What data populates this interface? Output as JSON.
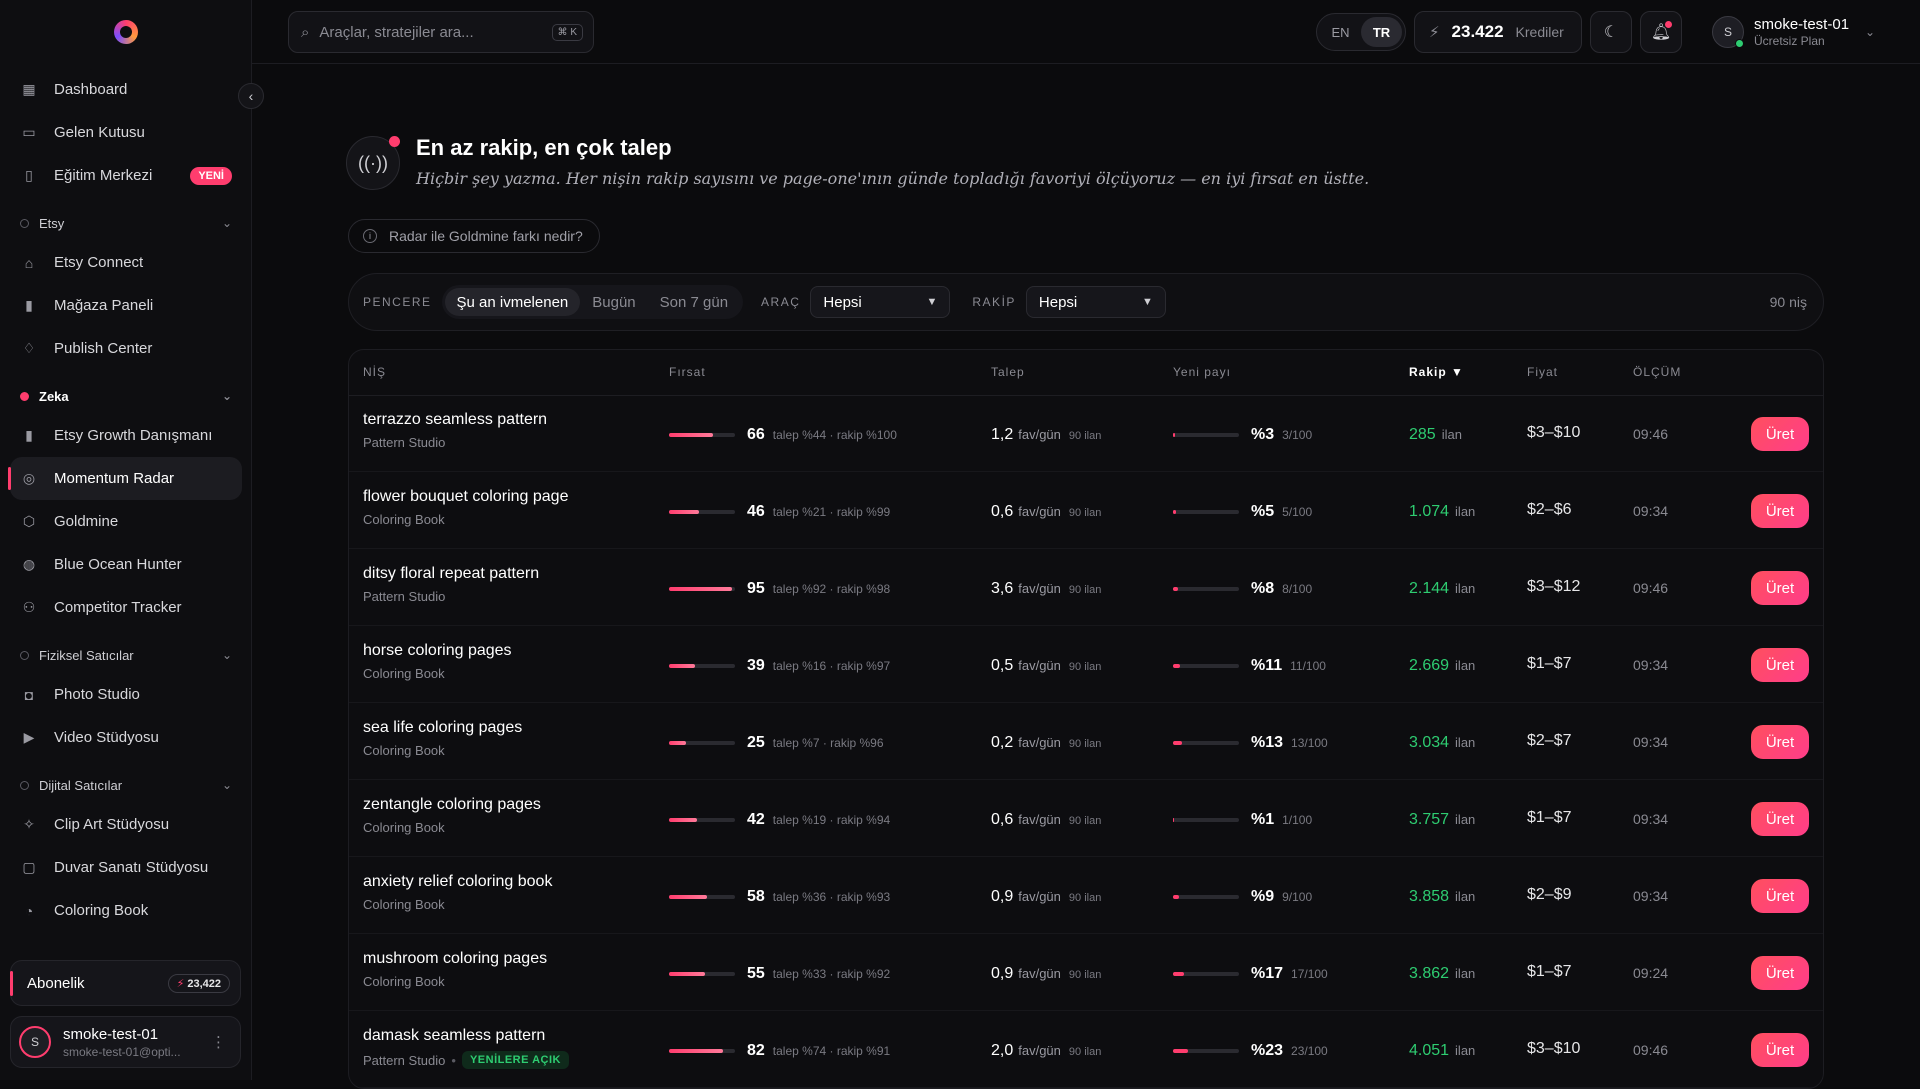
{
  "sidebar": {
    "top_items": [
      {
        "label": "Dashboard",
        "icon": "grid-icon"
      },
      {
        "label": "Gelen Kutusu",
        "icon": "inbox-icon"
      },
      {
        "label": "Eğitim Merkezi",
        "icon": "book-icon",
        "badge": "YENİ"
      }
    ],
    "groups": [
      {
        "label": "Etsy",
        "items": [
          {
            "label": "Etsy Connect",
            "icon": "store-icon"
          },
          {
            "label": "Mağaza Paneli",
            "icon": "bar-chart-icon"
          },
          {
            "label": "Publish Center",
            "icon": "bell-icon"
          }
        ]
      },
      {
        "label": "Zeka",
        "items": [
          {
            "label": "Etsy Growth Danışmanı",
            "icon": "bar-chart-icon"
          },
          {
            "label": "Momentum Radar",
            "icon": "radar-icon"
          },
          {
            "label": "Goldmine",
            "icon": "cube-icon"
          },
          {
            "label": "Blue Ocean Hunter",
            "icon": "globe-icon"
          },
          {
            "label": "Competitor Tracker",
            "icon": "users-icon"
          }
        ]
      },
      {
        "label": "Fiziksel Satıcılar",
        "items": [
          {
            "label": "Photo Studio",
            "icon": "camera-icon"
          },
          {
            "label": "Video Stüdyosu",
            "icon": "video-icon"
          }
        ]
      },
      {
        "label": "Dijital Satıcılar",
        "items": [
          {
            "label": "Clip Art Stüdyosu",
            "icon": "sparkle-icon"
          },
          {
            "label": "Duvar Sanatı Stüdyosu",
            "icon": "frame-icon"
          },
          {
            "label": "Coloring Book",
            "icon": "palette-icon"
          }
        ]
      }
    ],
    "subscription": {
      "label": "Abonelik",
      "credits": "23,422"
    },
    "user": {
      "initial": "S",
      "name": "smoke-test-01",
      "email": "smoke-test-01@opti..."
    }
  },
  "topbar": {
    "search_placeholder": "Araçlar, stratejiler ara...",
    "search_shortcut": "⌘ K",
    "lang": [
      "EN",
      "TR"
    ],
    "credits_value": "23.422",
    "credits_label": "Krediler",
    "user": {
      "initial": "S",
      "name": "smoke-test-01",
      "plan": "Ücretsiz Plan"
    }
  },
  "hero": {
    "title": "En az rakip, en çok talep",
    "subtitle": "Hiçbir şey yazma. Her nişin rakip sayısını ve page-one'ının günde topladığı favoriyi ölçüyoruz — en iyi fırsat en üstte.",
    "info": "Radar ile Goldmine farkı nedir?"
  },
  "filters": {
    "window_label": "PENCERE",
    "window_options": [
      "Şu an ivmelenen",
      "Bugün",
      "Son 7 gün"
    ],
    "tool_label": "ARAÇ",
    "tool_value": "Hepsi",
    "comp_label": "RAKİP",
    "comp_value": "Hepsi",
    "count": "90 niş"
  },
  "table": {
    "headers": {
      "niche": "NİŞ",
      "opportunity": "Fırsat",
      "demand": "Talep",
      "share": "Yeni payı",
      "competitors": "Rakip ▼",
      "price": "Fiyat",
      "measured": "ÖLÇÜM"
    },
    "button_label": "Üret",
    "rows": [
      {
        "name": "terrazzo seamless pattern",
        "category": "Pattern Studio",
        "score": "66",
        "score_frac": 0.66,
        "detail": "talep %44 · rakip %100",
        "demand": "1,2",
        "demand_unit": "fav/gün",
        "listings": "90 ilan",
        "share": "%3",
        "share_frac": 0.03,
        "share_detail": "3/100",
        "competitors": "285",
        "comp_unit": "ilan",
        "price": "$3–$10",
        "time": "09:46"
      },
      {
        "name": "flower bouquet coloring page",
        "category": "Coloring Book",
        "score": "46",
        "score_frac": 0.46,
        "detail": "talep %21 · rakip %99",
        "demand": "0,6",
        "demand_unit": "fav/gün",
        "listings": "90 ilan",
        "share": "%5",
        "share_frac": 0.05,
        "share_detail": "5/100",
        "competitors": "1.074",
        "comp_unit": "ilan",
        "price": "$2–$6",
        "time": "09:34"
      },
      {
        "name": "ditsy floral repeat pattern",
        "category": "Pattern Studio",
        "score": "95",
        "score_frac": 0.95,
        "detail": "talep %92 · rakip %98",
        "demand": "3,6",
        "demand_unit": "fav/gün",
        "listings": "90 ilan",
        "share": "%8",
        "share_frac": 0.08,
        "share_detail": "8/100",
        "competitors": "2.144",
        "comp_unit": "ilan",
        "price": "$3–$12",
        "time": "09:46"
      },
      {
        "name": "horse coloring pages",
        "category": "Coloring Book",
        "score": "39",
        "score_frac": 0.39,
        "detail": "talep %16 · rakip %97",
        "demand": "0,5",
        "demand_unit": "fav/gün",
        "listings": "90 ilan",
        "share": "%11",
        "share_frac": 0.11,
        "share_detail": "11/100",
        "competitors": "2.669",
        "comp_unit": "ilan",
        "price": "$1–$7",
        "time": "09:34"
      },
      {
        "name": "sea life coloring pages",
        "category": "Coloring Book",
        "score": "25",
        "score_frac": 0.25,
        "detail": "talep %7 · rakip %96",
        "demand": "0,2",
        "demand_unit": "fav/gün",
        "listings": "90 ilan",
        "share": "%13",
        "share_frac": 0.13,
        "share_detail": "13/100",
        "competitors": "3.034",
        "comp_unit": "ilan",
        "price": "$2–$7",
        "time": "09:34"
      },
      {
        "name": "zentangle coloring pages",
        "category": "Coloring Book",
        "score": "42",
        "score_frac": 0.42,
        "detail": "talep %19 · rakip %94",
        "demand": "0,6",
        "demand_unit": "fav/gün",
        "listings": "90 ilan",
        "share": "%1",
        "share_frac": 0.01,
        "share_detail": "1/100",
        "competitors": "3.757",
        "comp_unit": "ilan",
        "price": "$1–$7",
        "time": "09:34"
      },
      {
        "name": "anxiety relief coloring book",
        "category": "Coloring Book",
        "score": "58",
        "score_frac": 0.58,
        "detail": "talep %36 · rakip %93",
        "demand": "0,9",
        "demand_unit": "fav/gün",
        "listings": "90 ilan",
        "share": "%9",
        "share_frac": 0.09,
        "share_detail": "9/100",
        "competitors": "3.858",
        "comp_unit": "ilan",
        "price": "$2–$9",
        "time": "09:34"
      },
      {
        "name": "mushroom coloring pages",
        "category": "Coloring Book",
        "score": "55",
        "score_frac": 0.55,
        "detail": "talep %33 · rakip %92",
        "demand": "0,9",
        "demand_unit": "fav/gün",
        "listings": "90 ilan",
        "share": "%17",
        "share_frac": 0.17,
        "share_detail": "17/100",
        "competitors": "3.862",
        "comp_unit": "ilan",
        "price": "$1–$7",
        "time": "09:24"
      },
      {
        "name": "damask seamless pattern",
        "category": "Pattern Studio",
        "tag": "YENİLERE AÇIK",
        "score": "82",
        "score_frac": 0.82,
        "detail": "talep %74 · rakip %91",
        "demand": "2,0",
        "demand_unit": "fav/gün",
        "listings": "90 ilan",
        "share": "%23",
        "share_frac": 0.23,
        "share_detail": "23/100",
        "competitors": "4.051",
        "comp_unit": "ilan",
        "price": "$3–$10",
        "time": "09:46"
      }
    ]
  },
  "colors": {
    "accent": "#ff3d6e",
    "positive": "#2ecc71"
  }
}
